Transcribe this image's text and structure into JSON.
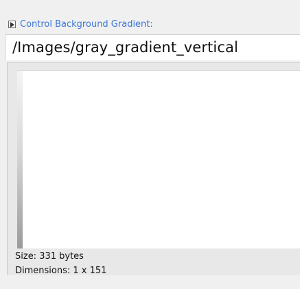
{
  "header": {
    "expand_icon": "expand-triangle-icon",
    "label": "Control Background Gradient:"
  },
  "path_field": {
    "value": "/Images/gray_gradient_vertical"
  },
  "preview": {
    "size_text": "Size: 331 bytes",
    "dimensions_text": "Dimensions: 1 x 151"
  },
  "colors": {
    "label_blue": "#3c78d8",
    "panel_bg": "#f0f0f0"
  }
}
